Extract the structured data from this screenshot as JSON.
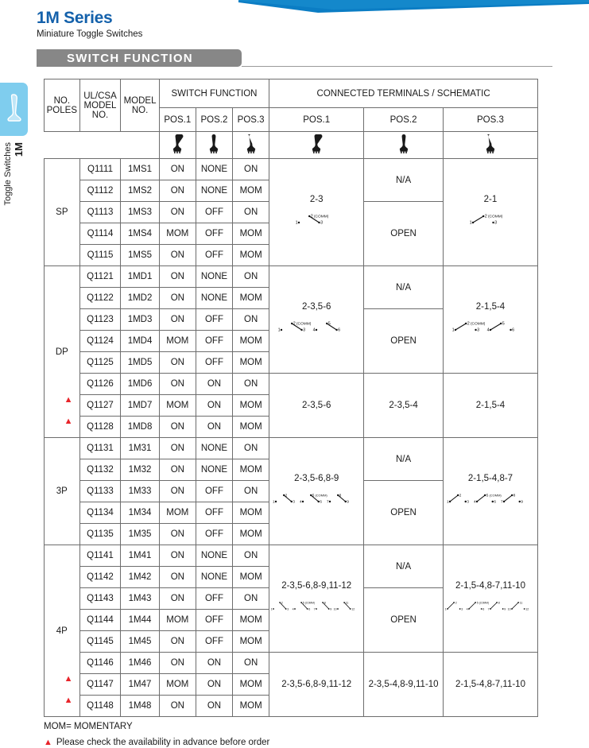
{
  "header": {
    "title": "1M Series",
    "subtitle": "Miniature Toggle Switches",
    "banner": "SWITCH  FUNCTION"
  },
  "sidebar": {
    "tab_code": "1M",
    "tab_label": "Toggle Switches",
    "icon": "toggle-switch-icon",
    "color": "#7fcdee"
  },
  "table": {
    "headers": {
      "no_poles": "NO.\nPOLES",
      "no_poles_l1": "NO.",
      "no_poles_l2": "POLES",
      "ulcsa_l1": "UL/CSA",
      "ulcsa_l2": "MODEL",
      "ulcsa_l3": "NO.",
      "model_l1": "MODEL",
      "model_l2": "NO.",
      "switch_function": "SWITCH FUNCTION",
      "connected_terminals": "CONNECTED TERMINALS / SCHEMATIC",
      "pos1": "POS.1",
      "pos2": "POS.2",
      "pos3": "POS.3"
    },
    "icons": {
      "pos1": "toggle-right-icon",
      "pos2": "toggle-center-icon",
      "pos3": "toggle-left-icon"
    },
    "blocks": [
      {
        "poles": "SP",
        "rows": [
          {
            "flag": "",
            "ulcsa": "Q1111",
            "model": "1MS1",
            "pos1": "ON",
            "pos2": "NONE",
            "pos3": "ON"
          },
          {
            "flag": "",
            "ulcsa": "Q1112",
            "model": "1MS2",
            "pos1": "ON",
            "pos2": "NONE",
            "pos3": "MOM"
          },
          {
            "flag": "",
            "ulcsa": "Q1113",
            "model": "1MS3",
            "pos1": "ON",
            "pos2": "OFF",
            "pos3": "ON"
          },
          {
            "flag": "",
            "ulcsa": "Q1114",
            "model": "1MS4",
            "pos1": "MOM",
            "pos2": "OFF",
            "pos3": "MOM"
          },
          {
            "flag": "",
            "ulcsa": "Q1115",
            "model": "1MS5",
            "pos1": "ON",
            "pos2": "OFF",
            "pos3": "MOM"
          }
        ],
        "terminals": {
          "pos1": "2-3",
          "pos2_na": "N/A",
          "pos2_open": "OPEN",
          "pos3": "2-1"
        }
      },
      {
        "poles": "DP",
        "rows": [
          {
            "flag": "",
            "ulcsa": "Q1121",
            "model": "1MD1",
            "pos1": "ON",
            "pos2": "NONE",
            "pos3": "ON"
          },
          {
            "flag": "",
            "ulcsa": "Q1122",
            "model": "1MD2",
            "pos1": "ON",
            "pos2": "NONE",
            "pos3": "MOM"
          },
          {
            "flag": "",
            "ulcsa": "Q1123",
            "model": "1MD3",
            "pos1": "ON",
            "pos2": "OFF",
            "pos3": "ON"
          },
          {
            "flag": "",
            "ulcsa": "Q1124",
            "model": "1MD4",
            "pos1": "MOM",
            "pos2": "OFF",
            "pos3": "MOM"
          },
          {
            "flag": "",
            "ulcsa": "Q1125",
            "model": "1MD5",
            "pos1": "ON",
            "pos2": "OFF",
            "pos3": "MOM"
          },
          {
            "flag": "",
            "ulcsa": "Q1126",
            "model": "1MD6",
            "pos1": "ON",
            "pos2": "ON",
            "pos3": "ON"
          },
          {
            "flag": "▲",
            "ulcsa": "Q1127",
            "model": "1MD7",
            "pos1": "MOM",
            "pos2": "ON",
            "pos3": "MOM"
          },
          {
            "flag": "▲",
            "ulcsa": "Q1128",
            "model": "1MD8",
            "pos1": "ON",
            "pos2": "ON",
            "pos3": "MOM"
          }
        ],
        "terminals": {
          "pos1": "2-3,5-6",
          "pos2_na": "N/A",
          "pos2_open": "OPEN",
          "pos3": "2-1,5-4",
          "pos1_b": "2-3,5-6",
          "pos2_b": "2-3,5-4",
          "pos3_b": "2-1,5-4"
        }
      },
      {
        "poles": "3P",
        "rows": [
          {
            "flag": "",
            "ulcsa": "Q1131",
            "model": "1M31",
            "pos1": "ON",
            "pos2": "NONE",
            "pos3": "ON"
          },
          {
            "flag": "",
            "ulcsa": "Q1132",
            "model": "1M32",
            "pos1": "ON",
            "pos2": "NONE",
            "pos3": "MOM"
          },
          {
            "flag": "",
            "ulcsa": "Q1133",
            "model": "1M33",
            "pos1": "ON",
            "pos2": "OFF",
            "pos3": "ON"
          },
          {
            "flag": "",
            "ulcsa": "Q1134",
            "model": "1M34",
            "pos1": "MOM",
            "pos2": "OFF",
            "pos3": "MOM"
          },
          {
            "flag": "",
            "ulcsa": "Q1135",
            "model": "1M35",
            "pos1": "ON",
            "pos2": "OFF",
            "pos3": "MOM"
          }
        ],
        "terminals": {
          "pos1": "2-3,5-6,8-9",
          "pos2_na": "N/A",
          "pos2_open": "OPEN",
          "pos3": "2-1,5-4,8-7"
        }
      },
      {
        "poles": "4P",
        "rows": [
          {
            "flag": "",
            "ulcsa": "Q1141",
            "model": "1M41",
            "pos1": "ON",
            "pos2": "NONE",
            "pos3": "ON"
          },
          {
            "flag": "",
            "ulcsa": "Q1142",
            "model": "1M42",
            "pos1": "ON",
            "pos2": "NONE",
            "pos3": "MOM"
          },
          {
            "flag": "",
            "ulcsa": "Q1143",
            "model": "1M43",
            "pos1": "ON",
            "pos2": "OFF",
            "pos3": "ON"
          },
          {
            "flag": "",
            "ulcsa": "Q1144",
            "model": "1M44",
            "pos1": "MOM",
            "pos2": "OFF",
            "pos3": "MOM"
          },
          {
            "flag": "",
            "ulcsa": "Q1145",
            "model": "1M45",
            "pos1": "ON",
            "pos2": "OFF",
            "pos3": "MOM"
          },
          {
            "flag": "",
            "ulcsa": "Q1146",
            "model": "1M46",
            "pos1": "ON",
            "pos2": "ON",
            "pos3": "ON"
          },
          {
            "flag": "▲",
            "ulcsa": "Q1147",
            "model": "1M47",
            "pos1": "MOM",
            "pos2": "ON",
            "pos3": "MOM"
          },
          {
            "flag": "▲",
            "ulcsa": "Q1148",
            "model": "1M48",
            "pos1": "ON",
            "pos2": "ON",
            "pos3": "MOM"
          }
        ],
        "terminals": {
          "pos1": "2-3,5-6,8-9,11-12",
          "pos2_na": "N/A",
          "pos2_open": "OPEN",
          "pos3": "2-1,5-4,8-7,11-10",
          "pos1_b": "2-3,5-6,8-9,11-12",
          "pos2_b": "2-3,5-4,8-9,11-10",
          "pos3_b": "2-1,5-4,8-7,11-10"
        }
      }
    ],
    "schematic_labels": {
      "comm": "(COMM)",
      "t1": "1",
      "t2": "2",
      "t3": "3",
      "t4": "4",
      "t5": "5",
      "t6": "6",
      "t7": "7",
      "t8": "8",
      "t9": "9",
      "t10": "10",
      "t11": "11",
      "t12": "12"
    }
  },
  "footnotes": {
    "line1": "MOM= MOMENTARY",
    "line2_marker": "▲",
    "line2": "Please check the availability in advance before order"
  },
  "colors": {
    "brand_blue": "#1461ab",
    "swoosh_blue": "#0b7dc4",
    "tab_blue": "#7fcdee",
    "banner_grey": "#878787",
    "flag_red": "#e8242a"
  }
}
